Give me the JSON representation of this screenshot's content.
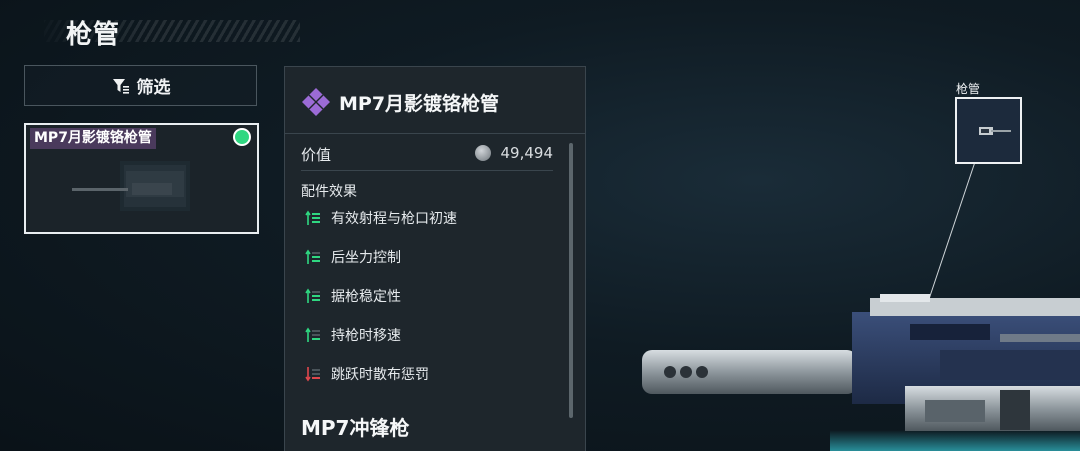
{
  "header": {
    "title": "枪管"
  },
  "filter": {
    "label": "筛选",
    "icon": "filter-icon"
  },
  "item_list": [
    {
      "name": "MP7月影镀铬枪管",
      "selected": true,
      "equipped": true
    }
  ],
  "detail": {
    "item_name": "MP7月影镀铬枪管",
    "rarity_color": "#9b6bd6",
    "value_label": "价值",
    "value_amount": "49,494",
    "effects_title": "配件效果",
    "effects": [
      {
        "label": "有效射程与枪口初速",
        "trend": "up"
      },
      {
        "label": "后坐力控制",
        "trend": "up"
      },
      {
        "label": "据枪稳定性",
        "trend": "up"
      },
      {
        "label": "持枪时移速",
        "trend": "up"
      },
      {
        "label": "跳跃时散布惩罚",
        "trend": "down"
      }
    ],
    "weapon_name": "MP7冲锋枪"
  },
  "slot": {
    "label": "枪管"
  },
  "colors": {
    "positive": "#2fd781",
    "negative": "#e0474c",
    "accent_purple": "#9b6bd6",
    "equipped": "#2fd781"
  }
}
